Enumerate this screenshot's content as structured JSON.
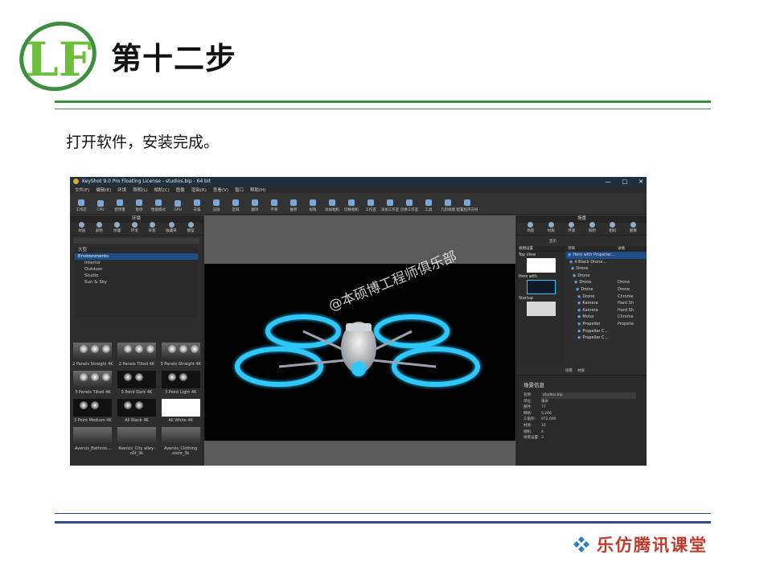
{
  "slide": {
    "title": "第十二步",
    "subtitle": "打开软件，安装完成。",
    "footer_brand": "乐仿腾讯课堂",
    "logo_text": "LF"
  },
  "app": {
    "window_title": "KeyShot 9.0 Pro Floating License - studios.bip - 64 bit",
    "window_controls": [
      "—",
      "□",
      "✕"
    ],
    "menu": [
      "文件(F)",
      "编辑(E)",
      "环境",
      "照明(L)",
      "相机(C)",
      "图像",
      "渲染(R)",
      "查看(V)",
      "窗口",
      "帮助(H)"
    ],
    "toolbar": [
      "工作区",
      "CPU",
      "使用量",
      "暂停",
      "性能模式",
      "GPU",
      "去噪",
      "渲染",
      "区域",
      "翻译",
      "平移",
      "推移",
      "视角",
      "添加相机",
      "切换相机",
      "工作室",
      "添加工作室",
      "切换工作室",
      "工具",
      "几何视图",
      "配置程序向导"
    ],
    "left_panel": {
      "header": "环境",
      "tabs": [
        "材质",
        "颜色",
        "纹理",
        "环境",
        "背景",
        "收藏夹",
        "模型"
      ],
      "tree": [
        {
          "label": "大型",
          "level": 0,
          "selected": false
        },
        {
          "label": "Environments",
          "level": 0,
          "selected": true
        },
        {
          "label": "Interior",
          "level": 1,
          "selected": false
        },
        {
          "label": "Outdoor",
          "level": 1,
          "selected": false
        },
        {
          "label": "Studio",
          "level": 1,
          "selected": false
        },
        {
          "label": "Sun & Sky",
          "level": 1,
          "selected": false
        }
      ],
      "thumbnails": [
        {
          "label": "2 Panels Straight 4K",
          "style": "studio"
        },
        {
          "label": "2 Panels Tilted 4K",
          "style": "studio"
        },
        {
          "label": "3 Panels Straight 4K",
          "style": "studio"
        },
        {
          "label": "3 Panels Tilted 4K",
          "style": "studio"
        },
        {
          "label": "3 Point Dark 4K",
          "style": "dark"
        },
        {
          "label": "3 Point Light 4K",
          "style": "dark"
        },
        {
          "label": "3 Point Medium 4K",
          "style": "dark"
        },
        {
          "label": "All Black 4K",
          "style": "dark"
        },
        {
          "label": "All White 4K",
          "style": "white"
        },
        {
          "label": "Aversis_Bathroo...",
          "style": "room"
        },
        {
          "label": "Aversis_City alley-old_3k",
          "style": "room"
        },
        {
          "label": "Aversis_Clothing store_3k",
          "style": "room"
        }
      ]
    },
    "watermark": "@本硕博工程师俱乐部",
    "right_panel": {
      "header": "场景",
      "tabs": [
        "场景",
        "材质",
        "环境",
        "照明",
        "相机",
        "图像"
      ],
      "search_label": "显示",
      "camera_column_header": "视图设置",
      "cameras": [
        "Top View",
        "Hero with",
        "Startup"
      ],
      "scene_headers": [
        "项目",
        "详情"
      ],
      "scene_rows": [
        {
          "name": "Hero with Propeller...",
          "detail": "",
          "selected": true
        },
        {
          "name": "X-Black Drone...",
          "detail": "",
          "selected": false
        },
        {
          "name": "Drone",
          "detail": "",
          "selected": false
        },
        {
          "name": "Drone",
          "detail": "",
          "selected": false
        },
        {
          "name": "Drone",
          "detail": "Drone",
          "selected": false
        },
        {
          "name": "Drone",
          "detail": "Drone",
          "selected": false
        },
        {
          "name": "Drone",
          "detail": "Chrome",
          "selected": false
        },
        {
          "name": "Kamera",
          "detail": "Hard Sh",
          "selected": false
        },
        {
          "name": "Kamera",
          "detail": "Hard Sh",
          "selected": false
        },
        {
          "name": "Motor",
          "detail": "Chrome",
          "selected": false
        },
        {
          "name": "Propeller",
          "detail": "Propelle",
          "selected": false
        },
        {
          "name": "Propeller C...",
          "detail": "",
          "selected": false
        },
        {
          "name": "Propeller C...",
          "detail": "",
          "selected": false
        }
      ],
      "subtabs": [
        "场景",
        "材质"
      ],
      "info_title": "场景信息",
      "info_rows": [
        {
          "key": "名称:",
          "value": "studios.bip",
          "boxed": true
        },
        {
          "key": "单位:",
          "value": "毫米",
          "boxed": false
        },
        {
          "key": "部件:",
          "value": "77",
          "boxed": false
        },
        {
          "key": "网格:",
          "value": "5,246",
          "boxed": false
        },
        {
          "key": "三角形:",
          "value": "972,690",
          "boxed": false
        },
        {
          "key": "材质:",
          "value": "10",
          "boxed": false
        },
        {
          "key": "相机:",
          "value": "4",
          "boxed": false
        },
        {
          "key": "场景设置:",
          "value": "3",
          "boxed": false
        }
      ]
    }
  },
  "colors": {
    "green_rule": "#3e8e41",
    "blue_rule": "#2d4a8a",
    "brand_red": "#c0392b",
    "neon_blue": "#2fc8ff",
    "selection_blue": "#1f4e8a"
  }
}
